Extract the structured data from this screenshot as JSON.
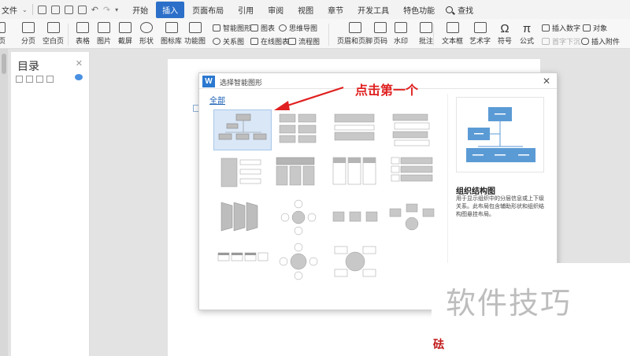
{
  "menubar": {
    "file_label": "文件",
    "tabs": [
      {
        "label": "开始",
        "active": false
      },
      {
        "label": "插入",
        "active": true
      },
      {
        "label": "页面布局",
        "active": false
      },
      {
        "label": "引用",
        "active": false
      },
      {
        "label": "审阅",
        "active": false
      },
      {
        "label": "视图",
        "active": false
      },
      {
        "label": "章节",
        "active": false
      },
      {
        "label": "开发工具",
        "active": false
      },
      {
        "label": "特色功能",
        "active": false
      }
    ],
    "search_label": "查找"
  },
  "ribbon": {
    "page_label": "页",
    "fenye_label": "分页",
    "blank_page_label": "空白页",
    "table_label": "表格",
    "picture_label": "图片",
    "screenshot_label": "截屏",
    "shape_label": "形状",
    "iconlib_label": "图标库",
    "func_chart_label": "功能图",
    "smart_shape_label": "智能图形",
    "chart_label": "图表",
    "mindmap_label": "思维导图",
    "relation_label": "关系图",
    "online_chart_label": "在线图表",
    "flowchart_label": "流程图",
    "header_footer_label": "页眉和页脚",
    "page_num_label": "页码",
    "watermark_label": "水印",
    "comment_label": "批注",
    "textbox_label": "文本框",
    "wordart_label": "艺术字",
    "symbol_label": "符号",
    "formula_label": "公式",
    "insert_number_label": "插入数字",
    "object_label": "对象",
    "first_letter_sink_label": "首字下沉",
    "insert_attachment_label": "插入附件"
  },
  "nav": {
    "title": "目录"
  },
  "dialog": {
    "title": "选择智能图形",
    "category": "全部",
    "preview_name": "组织结构图",
    "preview_desc": "用于显示组织中的分层信息或上下级关系。此布局包含辅助形状和组织结构图悬挂布局。"
  },
  "annotation": {
    "text": "点击第一个"
  },
  "watermark": {
    "text": "软件技巧",
    "red_fragment": "砝"
  },
  "colors": {
    "accent": "#2b6fc9",
    "box_blue": "#5b9bd5",
    "annotation_red": "#e02020"
  }
}
